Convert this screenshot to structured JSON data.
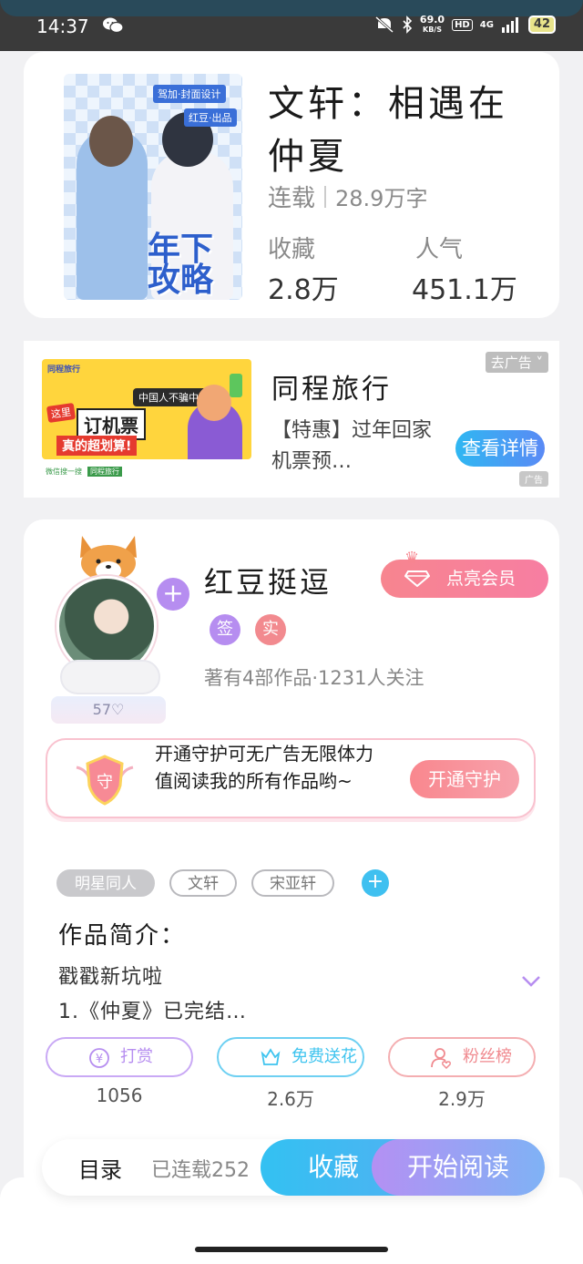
{
  "status_bar": {
    "time": "14:37",
    "net_speed_value": "69.0",
    "net_speed_unit": "KB/S",
    "hd": "HD",
    "signal": "4G",
    "battery": "42"
  },
  "book": {
    "cover": {
      "tag_top": "驾加·封面设计",
      "tag_mid": "红豆·出品",
      "big_text_line1": "年下",
      "big_text_line2": "攻略"
    },
    "title": "文轩：相遇在仲夏",
    "status": "连载",
    "word_count": "28.9万字",
    "favorites_label": "收藏",
    "favorites_value": "2.8万",
    "popularity_label": "人气",
    "popularity_value": "451.1万"
  },
  "ad": {
    "image": {
      "brand": "同程旅行",
      "slogan": "中国人不骗中国人",
      "here": "这里",
      "big": "订机票",
      "sub": "真的超划算!",
      "footer_left": "微信搜一搜",
      "footer_mid": "同程旅行"
    },
    "close_label": "去广告",
    "title": "同程旅行",
    "description": "【特惠】过年回家机票预…",
    "button_label": "查看详情",
    "flag": "广告"
  },
  "author": {
    "fan_count": "57♡",
    "name": "红豆挺逗",
    "vip_button": "点亮会员",
    "badge_sign": "签",
    "badge_real": "实",
    "info": "著有4部作品·1231人关注",
    "guard_icon_text": "守",
    "guard_text": "开通守护可无广告无限体力值阅读我的所有作品哟~",
    "guard_button": "开通守护",
    "tags": [
      "明星同人",
      "文轩",
      "宋亚轩"
    ],
    "intro_title": "作品简介：",
    "intro_line1": "戳戳新坑啦",
    "intro_line2": "1.《仲夏》已完结…",
    "actions": [
      {
        "label": "打赏",
        "count": "1056",
        "color": "#b68df0",
        "icon": "yen-icon"
      },
      {
        "label": "免费送花",
        "count": "2.6万",
        "color": "#3fc4ef",
        "icon": "flower-icon"
      },
      {
        "label": "粉丝榜",
        "count": "2.9万",
        "color": "#f08a8f",
        "icon": "user-heart-icon"
      }
    ]
  },
  "bottom_bar": {
    "toc_label": "目录",
    "toc_status": "已连载252",
    "collect_label": "收藏",
    "read_label": "开始阅读"
  },
  "colors": {
    "accent_blue": "#33c1f2",
    "accent_purple": "#b490f3",
    "accent_pink": "#f7858f"
  }
}
